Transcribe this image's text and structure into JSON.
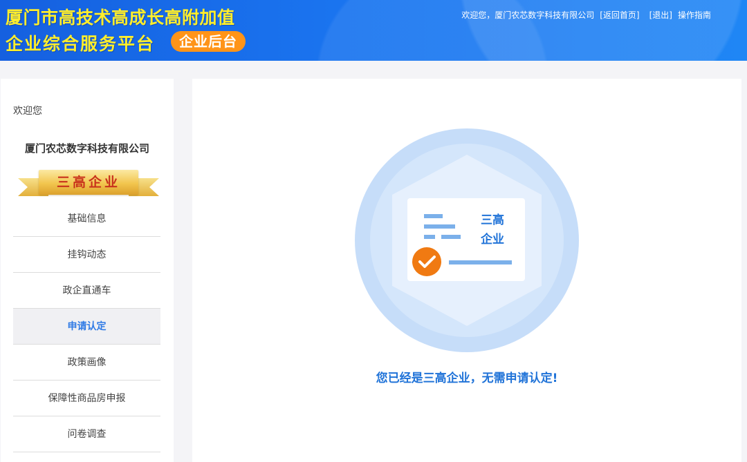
{
  "header": {
    "title_line1": "厦门市高技术高成长高附加值",
    "title_line2": "企业综合服务平台",
    "badge": "企业后台",
    "nav": {
      "greeting": "欢迎您，厦门农芯数字科技有限公司",
      "home_link": "[返回首页]",
      "logout_link": "[退出]",
      "guide_link": "操作指南"
    }
  },
  "sidebar": {
    "welcome": "欢迎您",
    "company": "厦门农芯数字科技有限公司",
    "ribbon": "三高企业",
    "items": [
      {
        "label": "基础信息"
      },
      {
        "label": "挂钩动态"
      },
      {
        "label": "政企直通车"
      },
      {
        "label": "申请认定",
        "active": true
      },
      {
        "label": "政策画像"
      },
      {
        "label": "保障性商品房申报"
      },
      {
        "label": "问卷调查"
      }
    ]
  },
  "main": {
    "card_text_line1": "三高",
    "card_text_line2": "企业",
    "message": "您已经是三高企业，无需申请认定!"
  },
  "colors": {
    "header_blue": "#1a74ef",
    "title_yellow": "#ffee2c",
    "badge_orange": "#ff9418",
    "accent_blue": "#2f7ae5",
    "check_orange": "#f07a12"
  }
}
